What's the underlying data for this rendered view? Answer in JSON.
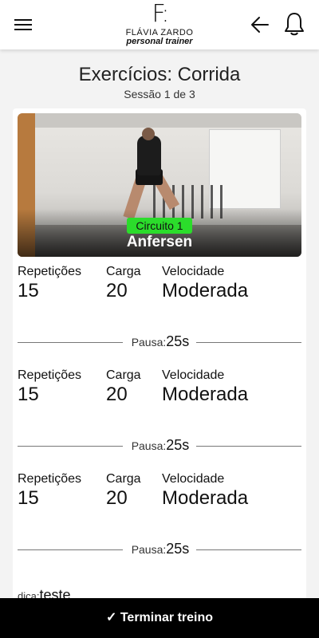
{
  "header": {
    "logo_mark": "F:",
    "logo_name": "FLÁVIA ZARDO",
    "logo_sub": "personal trainer",
    "menu_icon": "hamburger-menu-icon",
    "back_icon": "arrow-left-icon",
    "notifications_icon": "bell-icon"
  },
  "page": {
    "title": "Exercícios: Corrida",
    "session": "Sessão 1 de 3"
  },
  "exercise": {
    "circuit": "Circuito 1",
    "name": "Anfersen"
  },
  "labels": {
    "reps": "Repetições",
    "load": "Carga",
    "speed": "Velocidade",
    "pause": "Pausa:",
    "tip": "dica:"
  },
  "sets": [
    {
      "reps": "15",
      "load": "20",
      "speed": "Moderada",
      "pause": "25s"
    },
    {
      "reps": "15",
      "load": "20",
      "speed": "Moderada",
      "pause": "25s"
    },
    {
      "reps": "15",
      "load": "20",
      "speed": "Moderada",
      "pause": "25s"
    }
  ],
  "tip": {
    "text": "teste"
  },
  "finish": {
    "label": "✓ Terminar treino"
  },
  "colors": {
    "badge": "#2bdc2b",
    "bottom_bar": "#000000"
  }
}
